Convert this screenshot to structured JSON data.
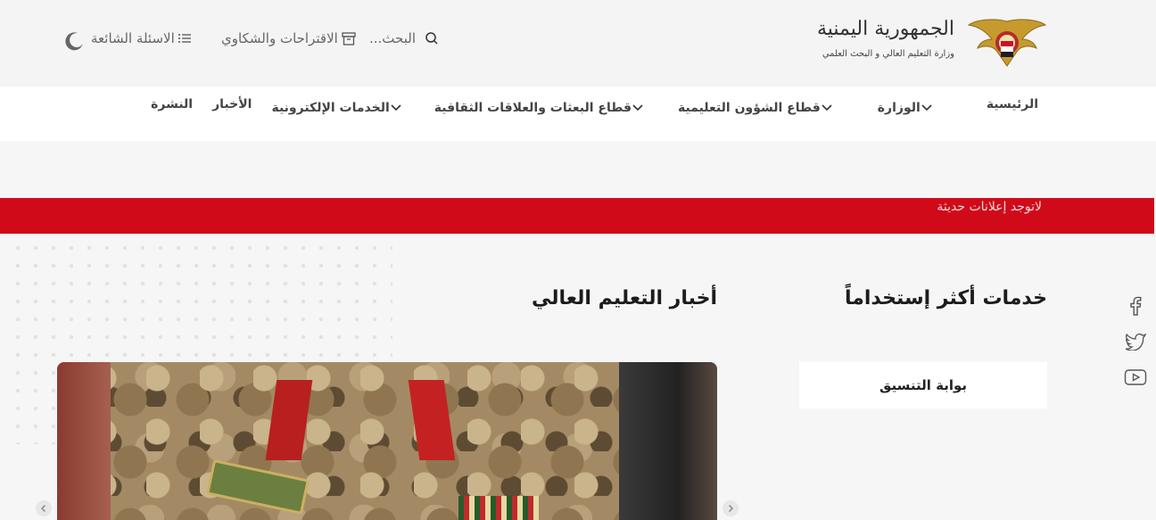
{
  "logo": {
    "title": "الجمهورية اليمنية",
    "subtitle": "وزارة التعليم العالي و البحث العلمي"
  },
  "header_tools": {
    "search_label": "البحث...",
    "suggestions_label": "الاقتراحات والشكاوي",
    "faq_label": "الاسئلة الشائعة"
  },
  "nav": {
    "items": [
      {
        "label": "الرئيسية",
        "has_dropdown": false
      },
      {
        "label": "الوزارة",
        "has_dropdown": true
      },
      {
        "label": "قطاع الشؤون التعليمية",
        "has_dropdown": true
      },
      {
        "label": "قطاع البعثات والعلاقات الثقافية",
        "has_dropdown": true
      },
      {
        "label": "الخدمات الإلكترونية",
        "has_dropdown": true
      },
      {
        "label": "الأخبار",
        "has_dropdown": false
      },
      {
        "label": "النشرة",
        "has_dropdown": false
      }
    ]
  },
  "announcement": {
    "text": "لاتوجد إعلانات حديثة"
  },
  "sections": {
    "services_title": "خدمات أكثر إستخداماً",
    "news_title": "أخبار التعليم العالي"
  },
  "services": [
    {
      "label": "بوابة  التنسيق"
    }
  ],
  "social": [
    "facebook-icon",
    "twitter-icon",
    "youtube-icon"
  ],
  "colors": {
    "accent_red": "#d10a1a",
    "header_bg": "#f4f4f4",
    "nav_bg": "#ffffff"
  }
}
